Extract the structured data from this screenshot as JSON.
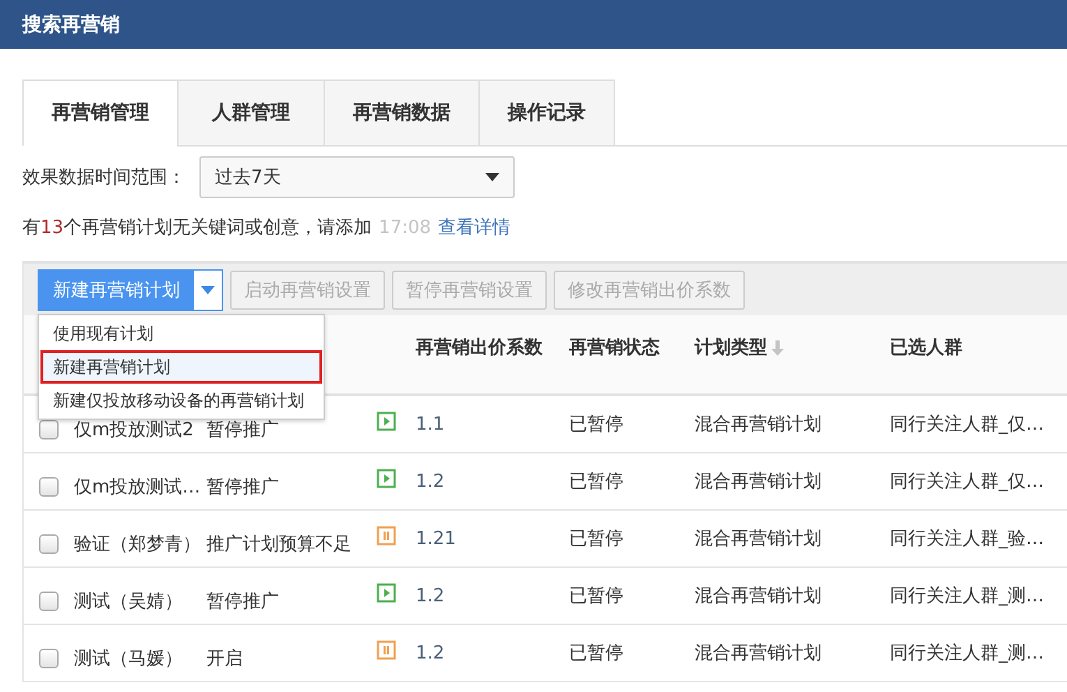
{
  "header": {
    "title": "搜索再营销"
  },
  "tabs": [
    {
      "label": "再营销管理",
      "selected": true
    },
    {
      "label": "人群管理",
      "selected": false
    },
    {
      "label": "再营销数据",
      "selected": false
    },
    {
      "label": "操作记录",
      "selected": false
    }
  ],
  "time_range": {
    "label": "效果数据时间范围：",
    "value": "过去7天"
  },
  "notice": {
    "prefix": "有",
    "count": "13",
    "suffix": "个再营销计划无关键词或创意，请添加",
    "time": "17:08",
    "link": "查看详情"
  },
  "toolbar": {
    "primary": "新建再营销计划",
    "buttons": [
      {
        "label": "启动再营销设置",
        "disabled": true
      },
      {
        "label": "暂停再营销设置",
        "disabled": true
      },
      {
        "label": "修改再营销出价系数",
        "disabled": true
      }
    ]
  },
  "dropdown": {
    "items": [
      {
        "label": "使用现有计划",
        "selected": false
      },
      {
        "label": "新建再营销计划",
        "selected": true
      },
      {
        "label": "新建仅投放移动设备的再营销计划",
        "selected": false
      }
    ]
  },
  "table": {
    "columns": [
      "再营销出价系数",
      "再营销状态",
      "计划类型",
      "已选人群"
    ],
    "rows": [
      {
        "checked": false,
        "name": "仅m投放测试2",
        "status": "暂停推广",
        "kind": "play",
        "coefficient": "1.1",
        "remarketing_status": "已暂停",
        "plan_type": "混合再营销计划",
        "crowd": "同行关注人群_仅…"
      },
      {
        "checked": false,
        "name": "仅m投放测试…",
        "status": "暂停推广",
        "kind": "play",
        "coefficient": "1.2",
        "remarketing_status": "已暂停",
        "plan_type": "混合再营销计划",
        "crowd": "同行关注人群_仅…"
      },
      {
        "checked": false,
        "name": "验证（郑梦青）",
        "status": "推广计划预算不足",
        "kind": "pause",
        "coefficient": "1.21",
        "remarketing_status": "已暂停",
        "plan_type": "混合再营销计划",
        "crowd": "同行关注人群_验…"
      },
      {
        "checked": false,
        "name": "测试（吴婧）",
        "status": "暂停推广",
        "kind": "play",
        "coefficient": "1.2",
        "remarketing_status": "已暂停",
        "plan_type": "混合再营销计划",
        "crowd": "同行关注人群_测…"
      },
      {
        "checked": false,
        "name": "测试（马媛）",
        "status": "开启",
        "kind": "pause",
        "coefficient": "1.2",
        "remarketing_status": "已暂停",
        "plan_type": "混合再营销计划",
        "crowd": "同行关注人群_测…"
      }
    ]
  }
}
